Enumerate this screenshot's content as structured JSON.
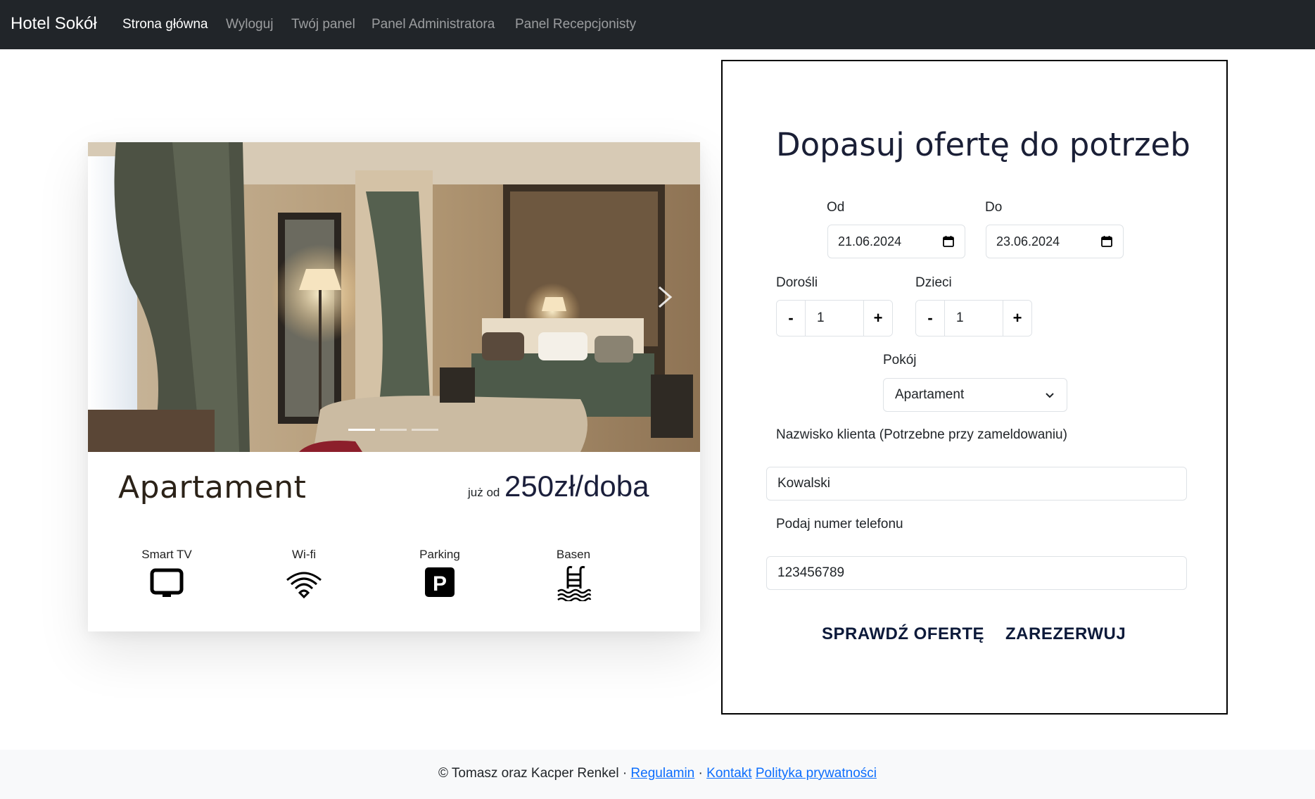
{
  "navbar": {
    "brand": "Hotel Sokół",
    "links": [
      "Strona główna",
      "Wyloguj",
      "Twój panel",
      "Panel Administratora",
      "Panel Recepcjonisty"
    ]
  },
  "room_card": {
    "title": "Apartament",
    "price_prefix": "już od",
    "price": "250zł/doba",
    "carousel_slides": 3,
    "active_slide": 1,
    "amenities": [
      {
        "label": "Smart TV",
        "icon": "tv-icon"
      },
      {
        "label": "Wi-fi",
        "icon": "wifi-icon"
      },
      {
        "label": "Parking",
        "icon": "parking-icon"
      },
      {
        "label": "Basen",
        "icon": "pool-icon"
      }
    ]
  },
  "form": {
    "title": "Dopasuj ofertę do potrzeb",
    "from_label": "Od",
    "from_value": "21.06.2024",
    "to_label": "Do",
    "to_value": "23.06.2024",
    "adults_label": "Dorośli",
    "adults_value": "1",
    "children_label": "Dzieci",
    "children_value": "1",
    "minus": "-",
    "plus": "+",
    "room_label": "Pokój",
    "room_value": "Apartament",
    "surname_label": "Nazwisko klienta (Potrzebne przy zameldowaniu)",
    "surname_value": "Kowalski",
    "phone_label": "Podaj numer telefonu",
    "phone_value": "123456789",
    "check_button": "SPRAWDŹ OFERTĘ",
    "book_button": "ZAREZERWUJ"
  },
  "footer": {
    "copyright": "© Tomasz oraz Kacper Renkel · ",
    "terms": "Regulamin",
    "sep": " · ",
    "contact": "Kontakt",
    "privacy": "Polityka prywatności"
  },
  "colors": {
    "navbar_bg": "#212529",
    "link_blue": "#0d6efd",
    "footer_bg": "#f8f9fa"
  }
}
